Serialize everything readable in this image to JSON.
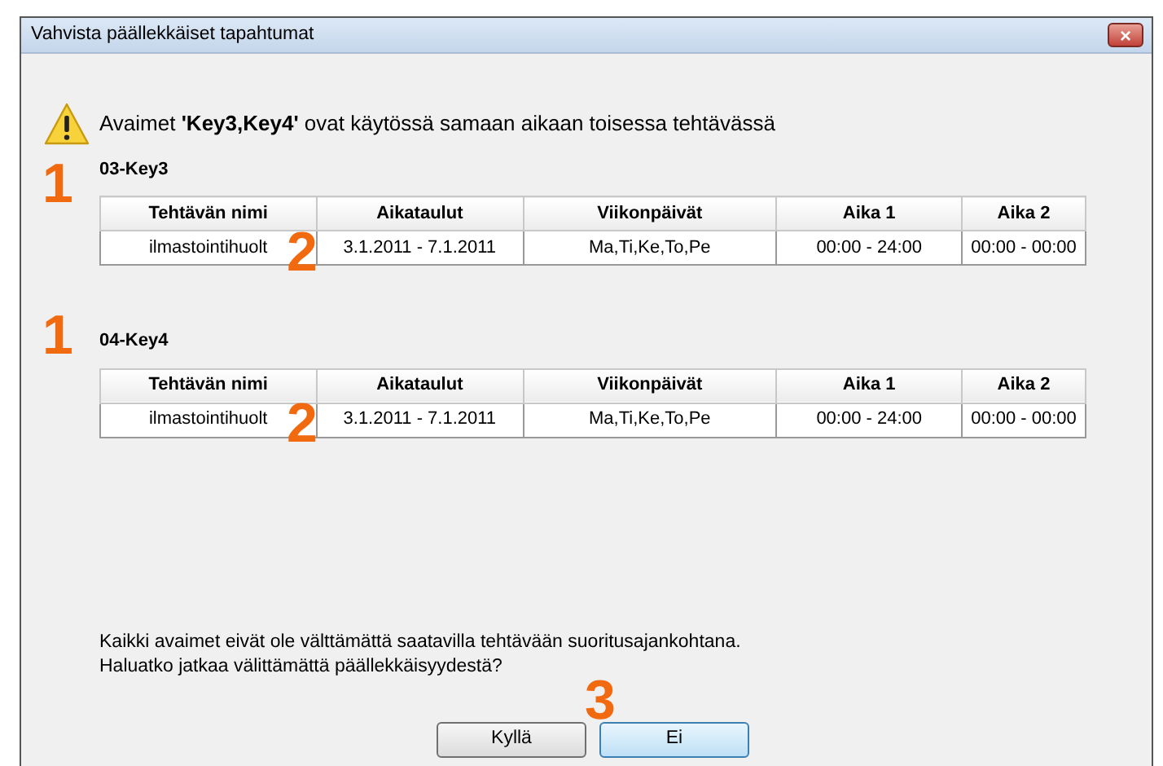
{
  "window": {
    "title": "Vahvista päällekkäiset tapahtumat",
    "close": "×"
  },
  "message": "Avaimet  **'Key3,Key4'**  ovat käytössä samaan aikaan toisessa tehtävässä",
  "sections": [
    {
      "callout": "1",
      "title": "03-Key3",
      "columns": [
        "Tehtävän nimi",
        "Aikataulut",
        "Viikonpäivät",
        "Aika 1",
        "Aika 2"
      ],
      "rows": [
        {
          "cells": [
            "ilmastointihuolt",
            "3.1.2011 - 7.1.2011",
            "Ma,Ti,Ke,To,Pe",
            "00:00 - 24:00",
            "00:00 - 00:00"
          ],
          "callout": "2"
        }
      ]
    },
    {
      "callout": "1",
      "title": "04-Key4",
      "columns": [
        "Tehtävän nimi",
        "Aikataulut",
        "Viikonpäivät",
        "Aika 1",
        "Aika 2"
      ],
      "rows": [
        {
          "cells": [
            "ilmastointihuolt",
            "3.1.2011 - 7.1.2011",
            "Ma,Ti,Ke,To,Pe",
            "00:00 - 24:00",
            "00:00 - 00:00"
          ],
          "callout": "2"
        }
      ]
    }
  ],
  "note": [
    "Kaikki avaimet eivät ole välttämättä saatavilla tehtävään suoritusajankohtana.",
    "Haluatko jatkaa välittämättä päällekkäisyydestä?"
  ],
  "buttons_callout": "3",
  "buttons": [
    {
      "label": "Kyllä",
      "focused": false
    },
    {
      "label": "Ei",
      "focused": true
    }
  ]
}
